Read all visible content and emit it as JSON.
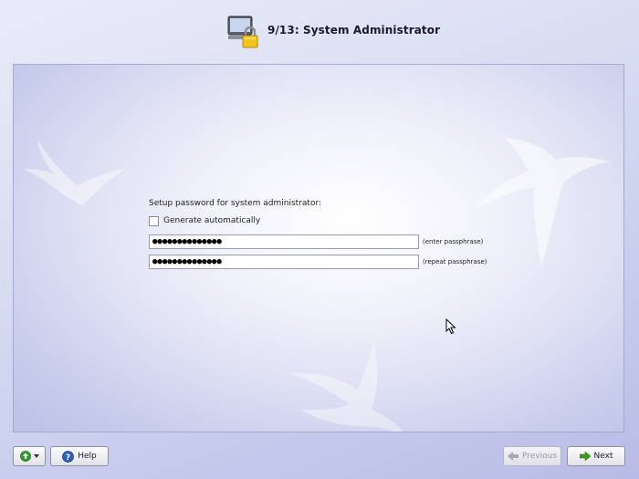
{
  "header": {
    "title": "9/13: System Administrator",
    "icon": "computer-lock-icon"
  },
  "form": {
    "prompt": "Setup password for system administrator:",
    "generate_label": "Generate automatically",
    "generate_checked": false,
    "password_masked": "●●●●●●●●●●●●●●",
    "password_hint": "(enter passphrase)",
    "repeat_masked": "●●●●●●●●●●●●●●",
    "repeat_hint": "(repeat passphrase)"
  },
  "footer": {
    "menu_button_icon": "green-circle-arrow-icon",
    "help_label": "Help",
    "previous_label": "Previous",
    "next_label": "Next"
  },
  "colors": {
    "next_arrow": "#3a9a1a",
    "help_badge": "#2d5fb8",
    "menu_icon": "#2f9e2f"
  }
}
